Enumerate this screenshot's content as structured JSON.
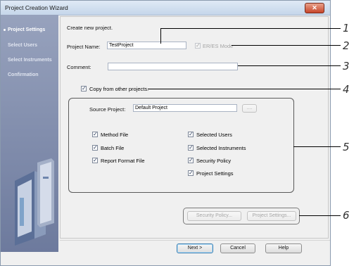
{
  "window": {
    "title": "Project Creation Wizard",
    "close_icon": "close-icon"
  },
  "sidebar": {
    "items": [
      {
        "label": "Project Settings",
        "active": true
      },
      {
        "label": "Select Users",
        "active": false
      },
      {
        "label": "Select Instruments",
        "active": false
      },
      {
        "label": "Confirmation",
        "active": false
      }
    ]
  },
  "form": {
    "heading": "Create new project.",
    "project_name_label": "Project Name:",
    "project_name_value": "TestProject",
    "eres_label": "ER/ES Mode",
    "comment_label": "Comment:",
    "comment_value": "",
    "copy_label": "Copy from other projects.",
    "source_label": "Source Project:",
    "source_value": "Default Project",
    "browse_label": "....",
    "options_left": [
      {
        "label": "Method File",
        "checked": true
      },
      {
        "label": "Batch File",
        "checked": true
      },
      {
        "label": "Report Format File",
        "checked": true
      }
    ],
    "options_right": [
      {
        "label": "Selected Users",
        "checked": true
      },
      {
        "label": "Selected Instruments",
        "checked": true
      },
      {
        "label": "Security Policy",
        "checked": true
      },
      {
        "label": "Project Settings",
        "checked": true
      }
    ],
    "security_policy_btn": "Security Policy...",
    "project_settings_btn": "Project Settings..."
  },
  "footer": {
    "next": "Next >",
    "cancel": "Cancel",
    "help": "Help"
  },
  "callouts": [
    "1",
    "2",
    "3",
    "4",
    "5",
    "6"
  ]
}
